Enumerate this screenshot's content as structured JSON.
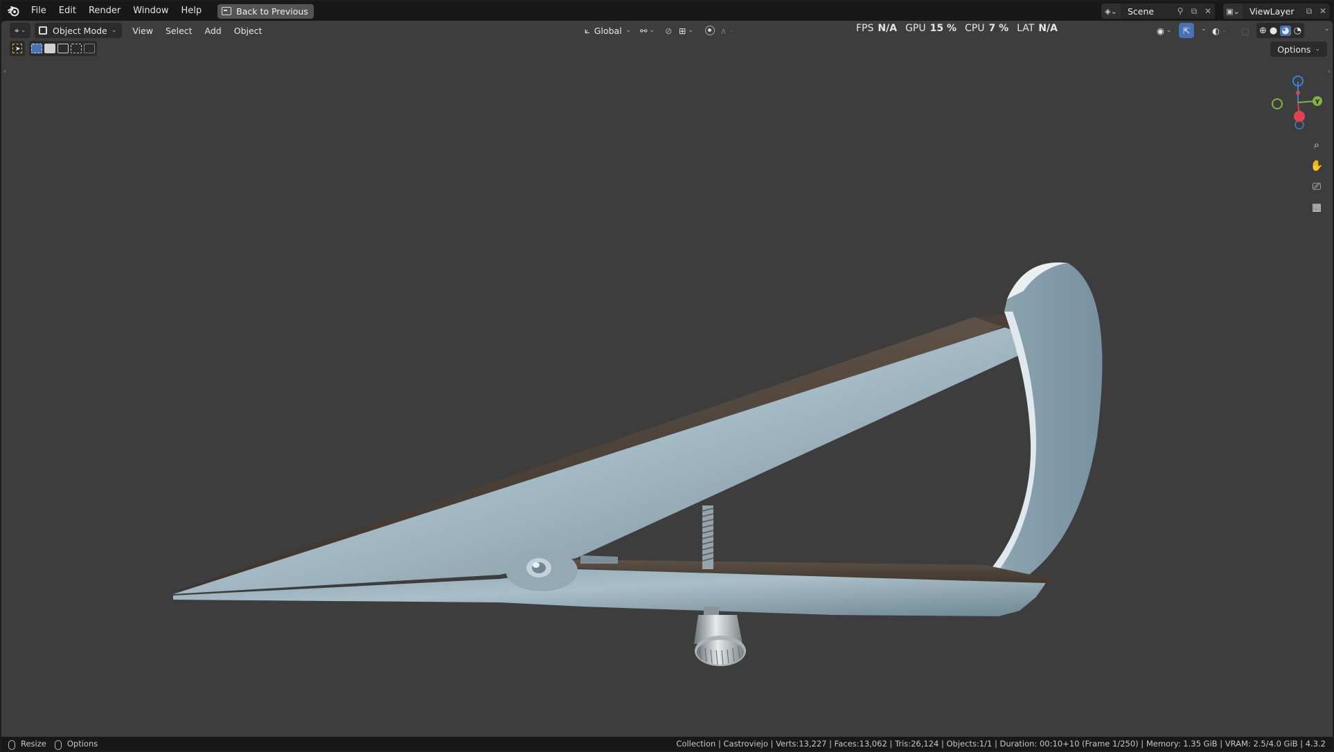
{
  "menubar": {
    "items": [
      "File",
      "Edit",
      "Render",
      "Window",
      "Help"
    ],
    "back_button": "Back to Previous",
    "scene": "Scene",
    "view_layer": "ViewLayer"
  },
  "viewport_header": {
    "editor_type": "3D Viewport",
    "mode": "Object Mode",
    "menus": [
      "View",
      "Select",
      "Add",
      "Object"
    ],
    "orientation": "Global",
    "options": "Options"
  },
  "stats": {
    "fps_label": "FPS",
    "fps_value": "N/A",
    "gpu_label": "GPU",
    "gpu_value": "15 %",
    "cpu_label": "CPU",
    "cpu_value": "7 %",
    "lat_label": "LAT",
    "lat_value": "N/A"
  },
  "gizmo": {
    "y_label": "Y"
  },
  "statusbar": {
    "left_items": [
      "Resize",
      "Options"
    ],
    "right_text": "Collection | Castroviejo | Verts:13,227 | Faces:13,062 | Tris:26,124 | Objects:1/1 | Duration: 00:10+10 (Frame 1/250) | Memory: 1.35 GiB | VRAM: 2.5/4.0 GiB | 4.3.2"
  },
  "colors": {
    "viewport_bg": "#3d3d3d",
    "header_bg": "#181818",
    "accent_blue": "#4772b3",
    "axis_x": "#e0424f",
    "axis_y": "#80b340",
    "axis_z": "#3b83d6"
  }
}
